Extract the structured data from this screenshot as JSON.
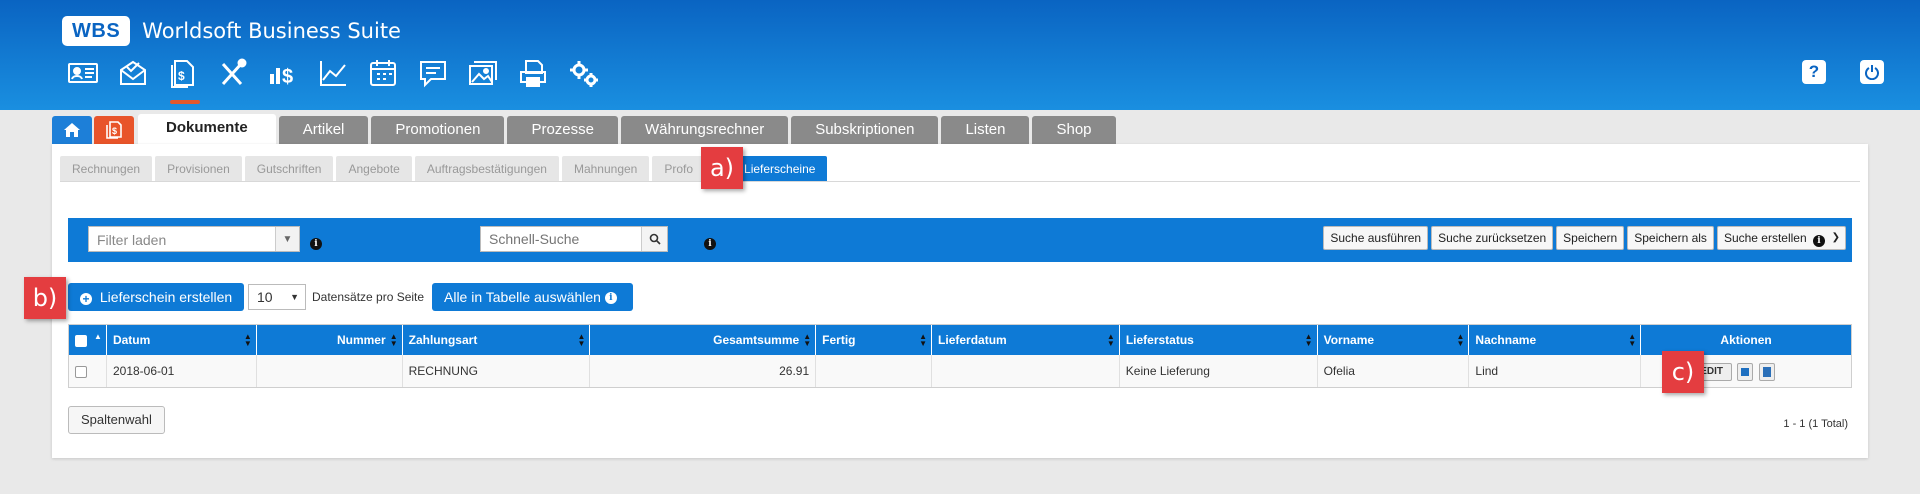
{
  "app": {
    "logo": "WBS",
    "name": "Worldsoft Business Suite"
  },
  "main_icons": [
    "contacts-icon",
    "mail-icon",
    "documents-icon",
    "tools-icon",
    "finance-icon",
    "statistics-icon",
    "calendar-icon",
    "chat-icon",
    "images-icon",
    "print-icon",
    "settings-icon"
  ],
  "right_icons": {
    "help": "?",
    "power": "power-icon"
  },
  "tabs": [
    "Dokumente",
    "Artikel",
    "Promotionen",
    "Prozesse",
    "Währungsrechner",
    "Subskriptionen",
    "Listen",
    "Shop"
  ],
  "subtabs": [
    "Rechnungen",
    "Provisionen",
    "Gutschriften",
    "Angebote",
    "Auftragsbestätigungen",
    "Mahnungen",
    "Profo",
    "Lieferscheine"
  ],
  "filter": {
    "load_placeholder": "Filter laden",
    "quick_search_placeholder": "Schnell-Suche",
    "buttons": [
      "Suche ausführen",
      "Suche zurücksetzen",
      "Speichern",
      "Speichern als",
      "Suche erstellen"
    ]
  },
  "actions": {
    "create_label": "Lieferschein erstellen",
    "per_page_value": "10",
    "per_page_label": "Datensätze pro Seite",
    "select_all_label": "Alle in Tabelle auswählen"
  },
  "table": {
    "headers": [
      "Datum",
      "Nummer",
      "Zahlungsart",
      "Gesamtsumme",
      "Fertig",
      "Lieferdatum",
      "Lieferstatus",
      "Vorname",
      "Nachname",
      "Aktionen"
    ],
    "rows": [
      {
        "datum": "2018-06-01",
        "nummer": "",
        "zahlungsart": "RECHNUNG",
        "gesamtsumme": "26.91",
        "fertig": "",
        "lieferdatum": "",
        "lieferstatus": "Keine Lieferung",
        "vorname": "Ofelia",
        "nachname": "Lind",
        "edit": "EDIT"
      }
    ]
  },
  "footer": {
    "column_choice": "Spaltenwahl",
    "paging": "1 - 1 (1 Total)"
  },
  "callouts": {
    "a": "a)",
    "b": "b)",
    "c": "c)"
  },
  "colors": {
    "header": "#0a64c2",
    "accent": "#0e7ad6",
    "callout": "#e43d40",
    "active_underline": "#e2582c"
  }
}
